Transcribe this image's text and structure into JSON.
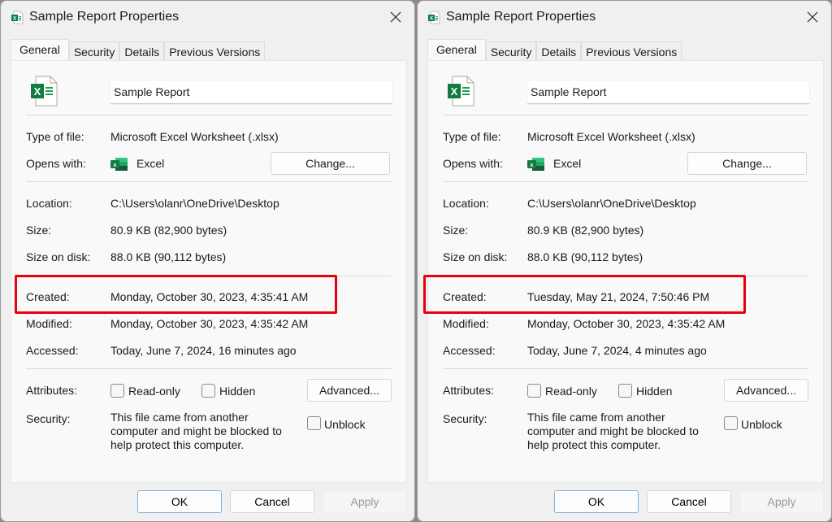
{
  "dialogs": [
    {
      "title": "Sample Report Properties",
      "tabs": [
        "General",
        "Security",
        "Details",
        "Previous Versions"
      ],
      "active_tab": "General",
      "file_name": "Sample Report",
      "type_of_file": {
        "label": "Type of file:",
        "value": "Microsoft Excel Worksheet (.xlsx)"
      },
      "opens_with": {
        "label": "Opens with:",
        "value": "Excel",
        "change_button": "Change..."
      },
      "location": {
        "label": "Location:",
        "value": "C:\\Users\\olanr\\OneDrive\\Desktop"
      },
      "size": {
        "label": "Size:",
        "value": "80.9 KB (82,900 bytes)"
      },
      "size_on_disk": {
        "label": "Size on disk:",
        "value": "88.0 KB (90,112 bytes)"
      },
      "created": {
        "label": "Created:",
        "value": "Monday, October 30, 2023, 4:35:41 AM"
      },
      "modified": {
        "label": "Modified:",
        "value": "Monday, October 30, 2023, 4:35:42 AM"
      },
      "accessed": {
        "label": "Accessed:",
        "value": "Today, June 7, 2024, 16 minutes ago"
      },
      "attributes": {
        "label": "Attributes:",
        "read_only": "Read-only",
        "hidden": "Hidden",
        "advanced_button": "Advanced...",
        "read_only_checked": false,
        "hidden_checked": false
      },
      "security": {
        "label": "Security:",
        "text": "This file came from another computer and might be blocked to help protect this computer.",
        "unblock": "Unblock",
        "unblock_checked": false
      },
      "footer": {
        "ok": "OK",
        "cancel": "Cancel",
        "apply": "Apply"
      }
    },
    {
      "title": "Sample Report Properties",
      "tabs": [
        "General",
        "Security",
        "Details",
        "Previous Versions"
      ],
      "active_tab": "General",
      "file_name": "Sample Report",
      "type_of_file": {
        "label": "Type of file:",
        "value": "Microsoft Excel Worksheet (.xlsx)"
      },
      "opens_with": {
        "label": "Opens with:",
        "value": "Excel",
        "change_button": "Change..."
      },
      "location": {
        "label": "Location:",
        "value": "C:\\Users\\olanr\\OneDrive\\Desktop"
      },
      "size": {
        "label": "Size:",
        "value": "80.9 KB (82,900 bytes)"
      },
      "size_on_disk": {
        "label": "Size on disk:",
        "value": "88.0 KB (90,112 bytes)"
      },
      "created": {
        "label": "Created:",
        "value": "Tuesday, May 21, 2024, 7:50:46 PM"
      },
      "modified": {
        "label": "Modified:",
        "value": "Monday, October 30, 2023, 4:35:42 AM"
      },
      "accessed": {
        "label": "Accessed:",
        "value": "Today, June 7, 2024, 4 minutes ago"
      },
      "attributes": {
        "label": "Attributes:",
        "read_only": "Read-only",
        "hidden": "Hidden",
        "advanced_button": "Advanced...",
        "read_only_checked": false,
        "hidden_checked": false
      },
      "security": {
        "label": "Security:",
        "text": "This file came from another computer and might be blocked to help protect this computer.",
        "unblock": "Unblock",
        "unblock_checked": false
      },
      "footer": {
        "ok": "OK",
        "cancel": "Cancel",
        "apply": "Apply"
      }
    }
  ],
  "icons": {
    "title_icon": "excel-file-icon",
    "close": "close-icon",
    "file_icon": "excel-file-icon",
    "app_icon": "excel-app-icon"
  },
  "colors": {
    "highlight": "#e8000b",
    "excel_green": "#107c41",
    "dialog_bg": "#f0f0f0",
    "panel_bg": "#f9f9f9"
  }
}
